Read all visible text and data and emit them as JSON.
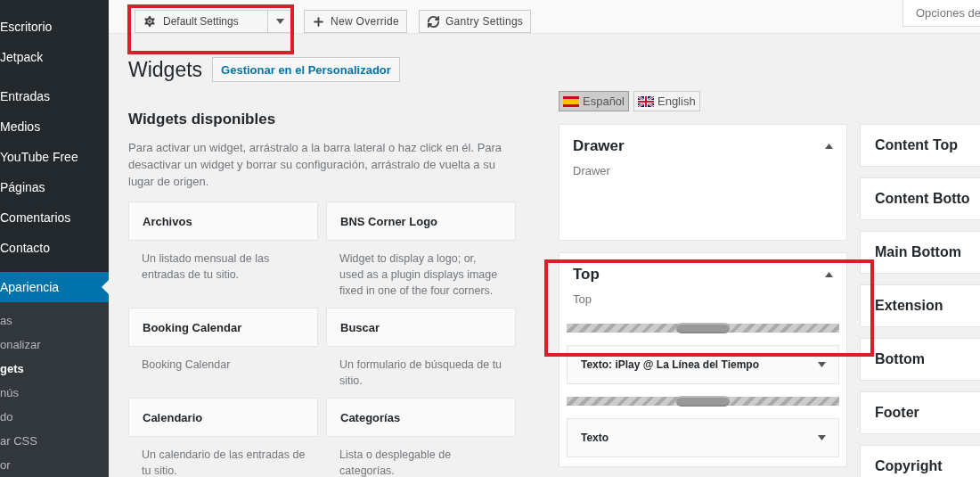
{
  "sidebar": {
    "groups": [
      {
        "items": [
          {
            "label": "Escritorio",
            "selected": false
          },
          {
            "label": "Jetpack",
            "selected": false
          }
        ]
      },
      {
        "items": [
          {
            "label": "Entradas",
            "selected": false
          },
          {
            "label": "Medios",
            "selected": false
          },
          {
            "label": "YouTube Free",
            "selected": false
          },
          {
            "label": "Páginas",
            "selected": false
          },
          {
            "label": "Comentarios",
            "selected": false
          },
          {
            "label": "Contacto",
            "selected": false
          }
        ]
      },
      {
        "items": [
          {
            "label": "Apariencia",
            "selected": true
          }
        ]
      }
    ],
    "submenu": [
      {
        "label": "as",
        "selected": false
      },
      {
        "label": "onalizar",
        "selected": false
      },
      {
        "label": "gets",
        "selected": true
      },
      {
        "label": "nús",
        "selected": false
      },
      {
        "label": "do",
        "selected": false
      },
      {
        "label": "ar CSS",
        "selected": false
      },
      {
        "label": "or",
        "selected": false
      }
    ]
  },
  "toolbar": {
    "settings_dropdown": {
      "label": "Default Settings",
      "highlighted": true
    },
    "buttons": [
      {
        "label": "New Override",
        "kind": "add"
      },
      {
        "label": "Gantry Settings",
        "kind": "sync"
      }
    ],
    "screen_options": "Opciones de"
  },
  "page": {
    "title": "Widgets",
    "customizer_button": "Gestionar en el Personalizador"
  },
  "available": {
    "heading": "Widgets disponibles",
    "description": "Para activar un widget, arrástralo a la barra lateral o haz click en él. Para desactivar un widget y borrar su configuración, arrástralo de vuelta a su lugar de origen.",
    "widgets": [
      {
        "name": "Archivos",
        "description": "Un listado mensual de las entradas de tu sitio."
      },
      {
        "name": "BNS Corner Logo",
        "description": "Widget to display a logo; or, used as a plugin displays image fixed in one of the four corners."
      },
      {
        "name": "Booking Calendar",
        "description": "Booking Calendar"
      },
      {
        "name": "Buscar",
        "description": "Un formulario de búsqueda de tu sitio."
      },
      {
        "name": "Calendario",
        "description": "Un calendario de las entradas de tu sitio."
      },
      {
        "name": "Categorías",
        "description": "Lista o desplegable de categorías."
      }
    ]
  },
  "languages": [
    {
      "label": "Español",
      "selected": true
    },
    {
      "label": "English",
      "selected": false
    }
  ],
  "sidebars": [
    {
      "title": "Drawer",
      "description": "Drawer",
      "expanded": true,
      "highlighted": false
    },
    {
      "title": "Top",
      "description": "Top",
      "expanded": true,
      "highlighted": true,
      "widgets": [
        {
          "title": "Texto: iPlay @ La Línea del Tiempo"
        },
        {
          "title": "Texto"
        }
      ]
    }
  ],
  "collapsed_sidebars": [
    {
      "title": "Content Top"
    },
    {
      "title": "Content Botto"
    },
    {
      "title": "Main Bottom"
    },
    {
      "title": "Extension"
    },
    {
      "title": "Bottom"
    },
    {
      "title": "Footer"
    },
    {
      "title": "Copyright"
    }
  ]
}
